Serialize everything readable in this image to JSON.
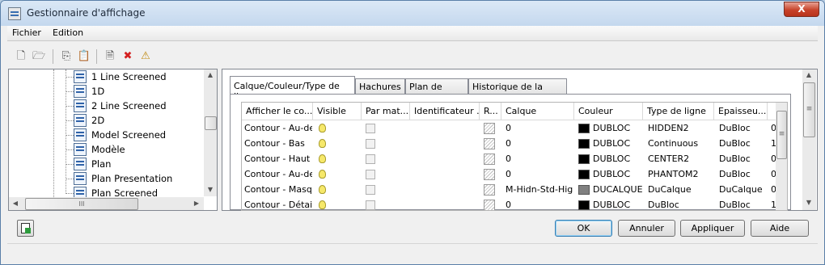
{
  "window": {
    "title": "Gestionnaire d'affichage",
    "close_glyph": "X"
  },
  "menu": [
    "Fichier",
    "Edition"
  ],
  "toolbar": {
    "icons": [
      "new-icon",
      "open-icon",
      "copy-icon",
      "paste-icon",
      "new-item-icon",
      "delete-icon",
      "purge-icon"
    ],
    "glyphs": [
      "🗋",
      "🗁",
      "⎘",
      "📋",
      "🗎",
      "✖",
      "⚠"
    ],
    "delete_color": "#d42020"
  },
  "tree": {
    "items": [
      "1 Line Screened",
      "1D",
      "2 Line Screened",
      "2D",
      "Model Screened",
      "Modèle",
      "Plan",
      "Plan Presentation",
      "Plan Screened"
    ],
    "hscroll_glyph": "III",
    "arrows": {
      "left": "◀",
      "right": "▶",
      "up": "▲",
      "down": "▼"
    }
  },
  "tabs": [
    "Calque/Couleur/Type de ligne",
    "Hachures",
    "Plan de coupe",
    "Historique de la version"
  ],
  "active_tab": 0,
  "grid": {
    "columns": [
      "Afficher le co...",
      "Visible",
      "Par mat...",
      "Identificateur ...",
      "R...",
      "Calque",
      "Couleur",
      "Type de ligne",
      "Epaisseu...",
      ""
    ],
    "rows": [
      {
        "name": "Contour - Au-desso",
        "layer": "0",
        "color": "DUBLOC",
        "swatch": "#000000",
        "linetype": "HIDDEN2",
        "weight": "DuBloc",
        "extra": "0"
      },
      {
        "name": "Contour - Bas",
        "layer": "0",
        "color": "DUBLOC",
        "swatch": "#000000",
        "linetype": "Continuous",
        "weight": "DuBloc",
        "extra": "1"
      },
      {
        "name": "Contour - Haut",
        "layer": "0",
        "color": "DUBLOC",
        "swatch": "#000000",
        "linetype": "CENTER2",
        "weight": "DuBloc",
        "extra": "0"
      },
      {
        "name": "Contour - Au-desso",
        "layer": "0",
        "color": "DUBLOC",
        "swatch": "#000000",
        "linetype": "PHANTOM2",
        "weight": "DuBloc",
        "extra": "0"
      },
      {
        "name": "Contour - Masqué",
        "layer": "M-Hidn-Std-High",
        "color": "DUCALQUE",
        "swatch": "#808080",
        "linetype": "DuCalque",
        "weight": "DuCalque",
        "extra": "0"
      },
      {
        "name": "Contour - Détails -",
        "layer": "0",
        "color": "DUBLOC",
        "swatch": "#000000",
        "linetype": "DuBloc",
        "weight": "DuBloc",
        "extra": "1"
      }
    ],
    "scroll_grip": "≡"
  },
  "buttons": {
    "ok": "OK",
    "cancel": "Annuler",
    "apply": "Appliquer",
    "help": "Aide"
  },
  "bottom_icon": "export-icon"
}
